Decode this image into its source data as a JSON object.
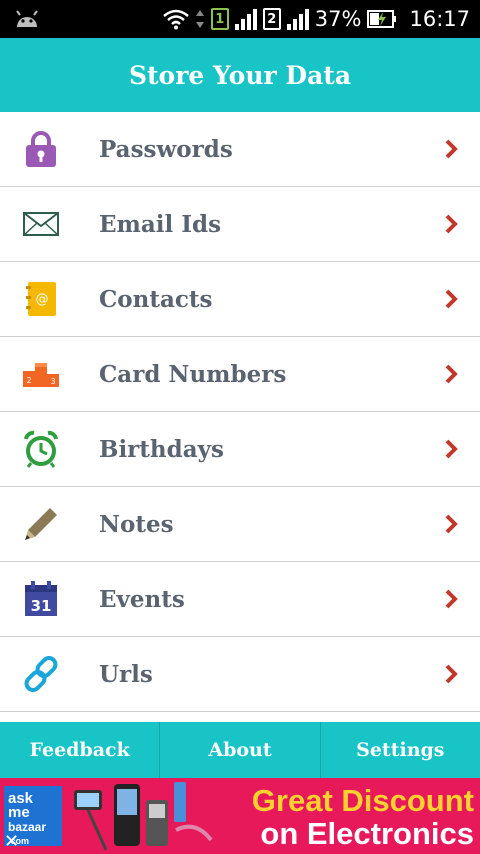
{
  "status_bar": {
    "sim1": "1",
    "sim2": "2",
    "battery_percent": "37%",
    "time": "16:17"
  },
  "header": {
    "title": "Store Your Data"
  },
  "menu": [
    {
      "label": "Passwords",
      "icon": "lock-icon",
      "color": "#9b59b6"
    },
    {
      "label": "Email Ids",
      "icon": "envelope-icon",
      "color": "#2e5d4b"
    },
    {
      "label": "Contacts",
      "icon": "address-book-icon",
      "color": "#f5b800"
    },
    {
      "label": "Card Numbers",
      "icon": "podium-icon",
      "color": "#f26522"
    },
    {
      "label": "Birthdays",
      "icon": "alarm-clock-icon",
      "color": "#2e9e3f"
    },
    {
      "label": "Notes",
      "icon": "pencil-icon",
      "color": "#8a7a55"
    },
    {
      "label": "Events",
      "icon": "calendar-icon",
      "color": "#3f4aa0"
    },
    {
      "label": "Urls",
      "icon": "link-icon",
      "color": "#1aa6d9"
    }
  ],
  "bottom_nav": {
    "feedback": "Feedback",
    "about": "About",
    "settings": "Settings"
  },
  "ad": {
    "logo_line1": "ask",
    "logo_line2": "me",
    "logo_line3": "bazaar",
    "logo_line4": ".com",
    "headline1": "Great Discount",
    "headline2": "on Electronics",
    "close": "✕"
  },
  "colors": {
    "accent": "#18c4c6",
    "chevron": "#c0392b",
    "label": "#5a6470"
  }
}
